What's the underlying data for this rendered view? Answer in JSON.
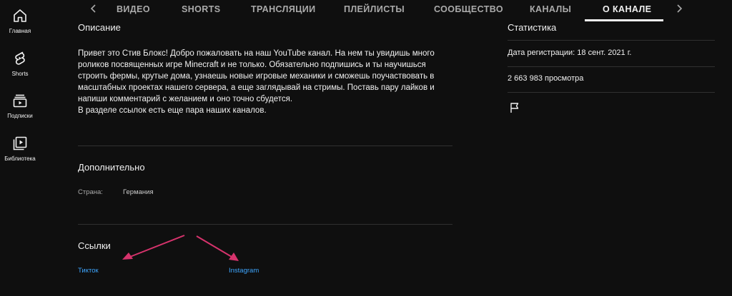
{
  "guide": {
    "items": [
      {
        "label": "Главная",
        "icon": "home-icon"
      },
      {
        "label": "Shorts",
        "icon": "shorts-icon"
      },
      {
        "label": "Подписки",
        "icon": "subscriptions-icon"
      },
      {
        "label": "Библиотека",
        "icon": "library-icon"
      }
    ]
  },
  "tabs": {
    "items": [
      "ВИДЕО",
      "SHORTS",
      "ТРАНСЛЯЦИИ",
      "ПЛЕЙЛИСТЫ",
      "СООБЩЕСТВО",
      "КАНАЛЫ",
      "О КАНАЛЕ"
    ],
    "active": "О КАНАЛЕ"
  },
  "about": {
    "description_title": "Описание",
    "description_lines": [
      "Привет это Стив Блокс! Добро пожаловать на наш YouTube канал. На нем ты увидишь много",
      "роликов посвященных игре Minecraft и не только. Обязательно подпишись и ты научишься",
      "строить фермы, крутые дома, узнаешь новые игровые механики и сможешь поучаствовать в",
      "масштабных проектах нашего сервера, а еще заглядывай на стримы. Поставь пару лайков и",
      "напиши комментарий  с желанием и оно точно сбудется.",
      "В разделе ссылок есть еще пара наших каналов."
    ],
    "details_title": "Дополнительно",
    "country_label": "Страна:",
    "country_value": "Германия",
    "links_title": "Ссылки",
    "links": [
      {
        "label": "Тикток"
      },
      {
        "label": "Instagram"
      }
    ]
  },
  "stats": {
    "title": "Статистика",
    "joined": "Дата регистрации: 18 сент. 2021 г.",
    "views": "2 663 983 просмотра",
    "report_icon": "flag-icon"
  },
  "colors": {
    "background": "#0f0f0f",
    "text": "#f1f1f1",
    "secondary": "#aaaaaa",
    "link": "#3ea6ff",
    "annotation_arrow": "#d6336c"
  }
}
